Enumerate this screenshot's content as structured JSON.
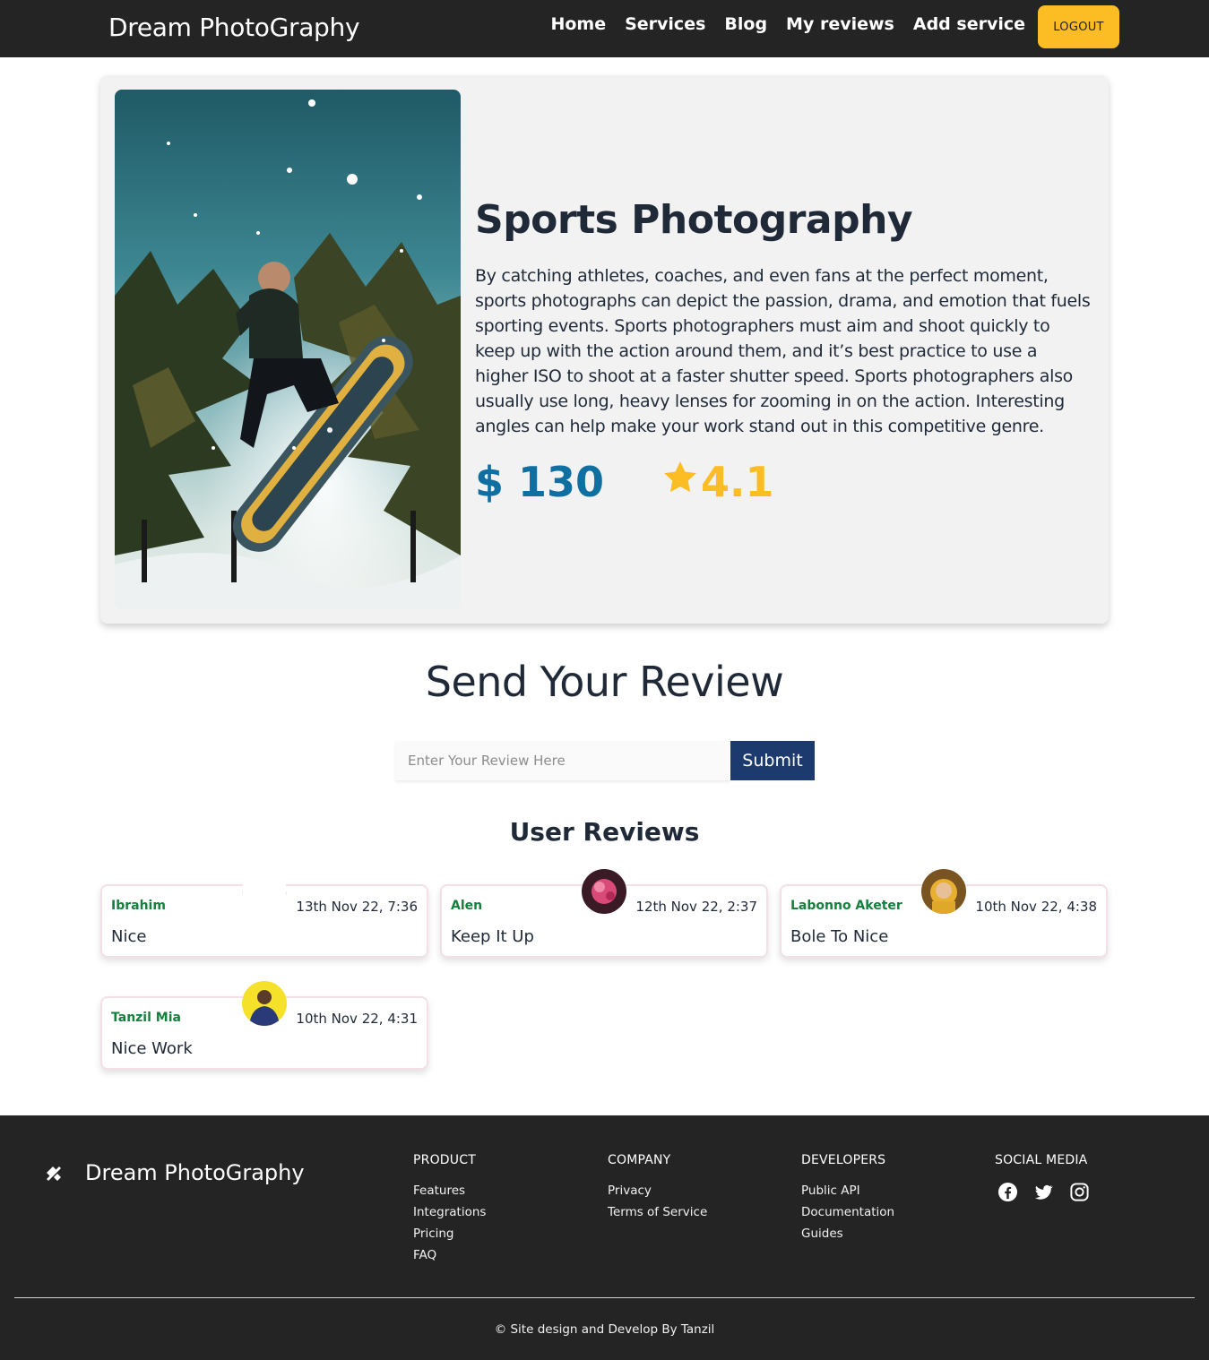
{
  "brand": "Dream PhotoGraphy",
  "nav": {
    "links": [
      "Home",
      "Services",
      "Blog",
      "My reviews",
      "Add service"
    ],
    "logout_label": "LOGOUT"
  },
  "service": {
    "title": "Sports Photography",
    "description": "By catching athletes, coaches, and even fans at the perfect moment, sports photographs can depict the passion, drama, and emotion that fuels sporting events. Sports photographers must aim and shoot quickly to keep up with the action around them, and it’s best practice to use a higher ISO to shoot at a faster shutter speed. Sports photographers also usually use long, heavy lenses for zooming in on the action. Interesting angles can help make your work stand out in this competitive genre.",
    "price": "$ 130",
    "rating": "4.1"
  },
  "review_form": {
    "heading": "Send Your Review",
    "placeholder": "Enter Your Review Here",
    "submit_label": "Submit"
  },
  "reviews_title": "User Reviews",
  "reviews": [
    {
      "name": "Ibrahim",
      "date": "13th Nov 22, 7:36",
      "text": "Nice",
      "avatar": "blank"
    },
    {
      "name": "Alen",
      "date": "12th Nov 22, 2:37",
      "text": "Keep It Up",
      "avatar": "pink-flower"
    },
    {
      "name": "Labonno Aketer",
      "date": "10th Nov 22, 4:38",
      "text": "Bole To Nice",
      "avatar": "child-yellow"
    },
    {
      "name": "Tanzil Mia",
      "date": "10th Nov 22, 4:31",
      "text": "Nice Work",
      "avatar": "man-yellow-bg"
    }
  ],
  "footer": {
    "brand": "Dream PhotoGraphy",
    "columns": [
      {
        "title": "PRODUCT",
        "links": [
          "Features",
          "Integrations",
          "Pricing",
          "FAQ"
        ]
      },
      {
        "title": "COMPANY",
        "links": [
          "Privacy",
          "Terms of Service"
        ]
      },
      {
        "title": "DEVELOPERS",
        "links": [
          "Public API",
          "Documentation",
          "Guides"
        ]
      }
    ],
    "social_title": "SOCIAL MEDIA",
    "social_icons": [
      "facebook-icon",
      "twitter-icon",
      "instagram-icon"
    ],
    "copyright": "© Site design and Develop By Tanzil"
  },
  "colors": {
    "navbar_bg": "#242424",
    "accent_yellow": "#fbbd23",
    "price_blue": "#0e6fa0",
    "submit_navy": "#1c3a6e",
    "reviewer_green": "#15803d"
  }
}
